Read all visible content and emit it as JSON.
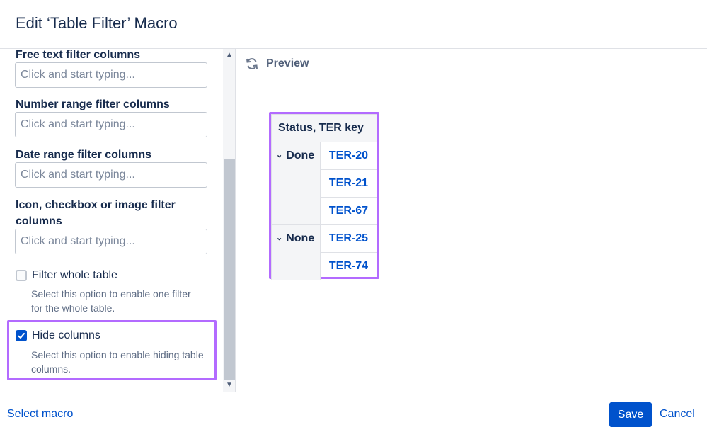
{
  "dialog": {
    "title": "Edit ‘Table Filter’ Macro"
  },
  "fields": [
    {
      "label": "Free text filter columns",
      "placeholder": "Click and start typing..."
    },
    {
      "label": "Number range filter columns",
      "placeholder": "Click and start typing..."
    },
    {
      "label": "Date range filter columns",
      "placeholder": "Click and start typing..."
    },
    {
      "label": "Icon, checkbox or image filter columns",
      "placeholder": "Click and start typing..."
    }
  ],
  "options": [
    {
      "label": "Filter whole table",
      "description": "Select this option to enable one filter for the whole table.",
      "checked": false
    },
    {
      "label": "Hide columns",
      "description": "Select this option to enable hiding table columns.",
      "checked": true
    }
  ],
  "preview": {
    "label": "Preview",
    "icon": "refresh-icon",
    "table": {
      "header": "Status, TER key",
      "groups": [
        {
          "name": "Done",
          "keys": [
            "TER-20",
            "TER-21",
            "TER-67"
          ]
        },
        {
          "name": "None",
          "keys": [
            "TER-25",
            "TER-74"
          ]
        }
      ]
    }
  },
  "footer": {
    "select_macro": "Select macro",
    "save": "Save",
    "cancel": "Cancel"
  },
  "colors": {
    "accent": "#0052cc",
    "highlight": "#b36bff",
    "text": "#172b4d"
  }
}
